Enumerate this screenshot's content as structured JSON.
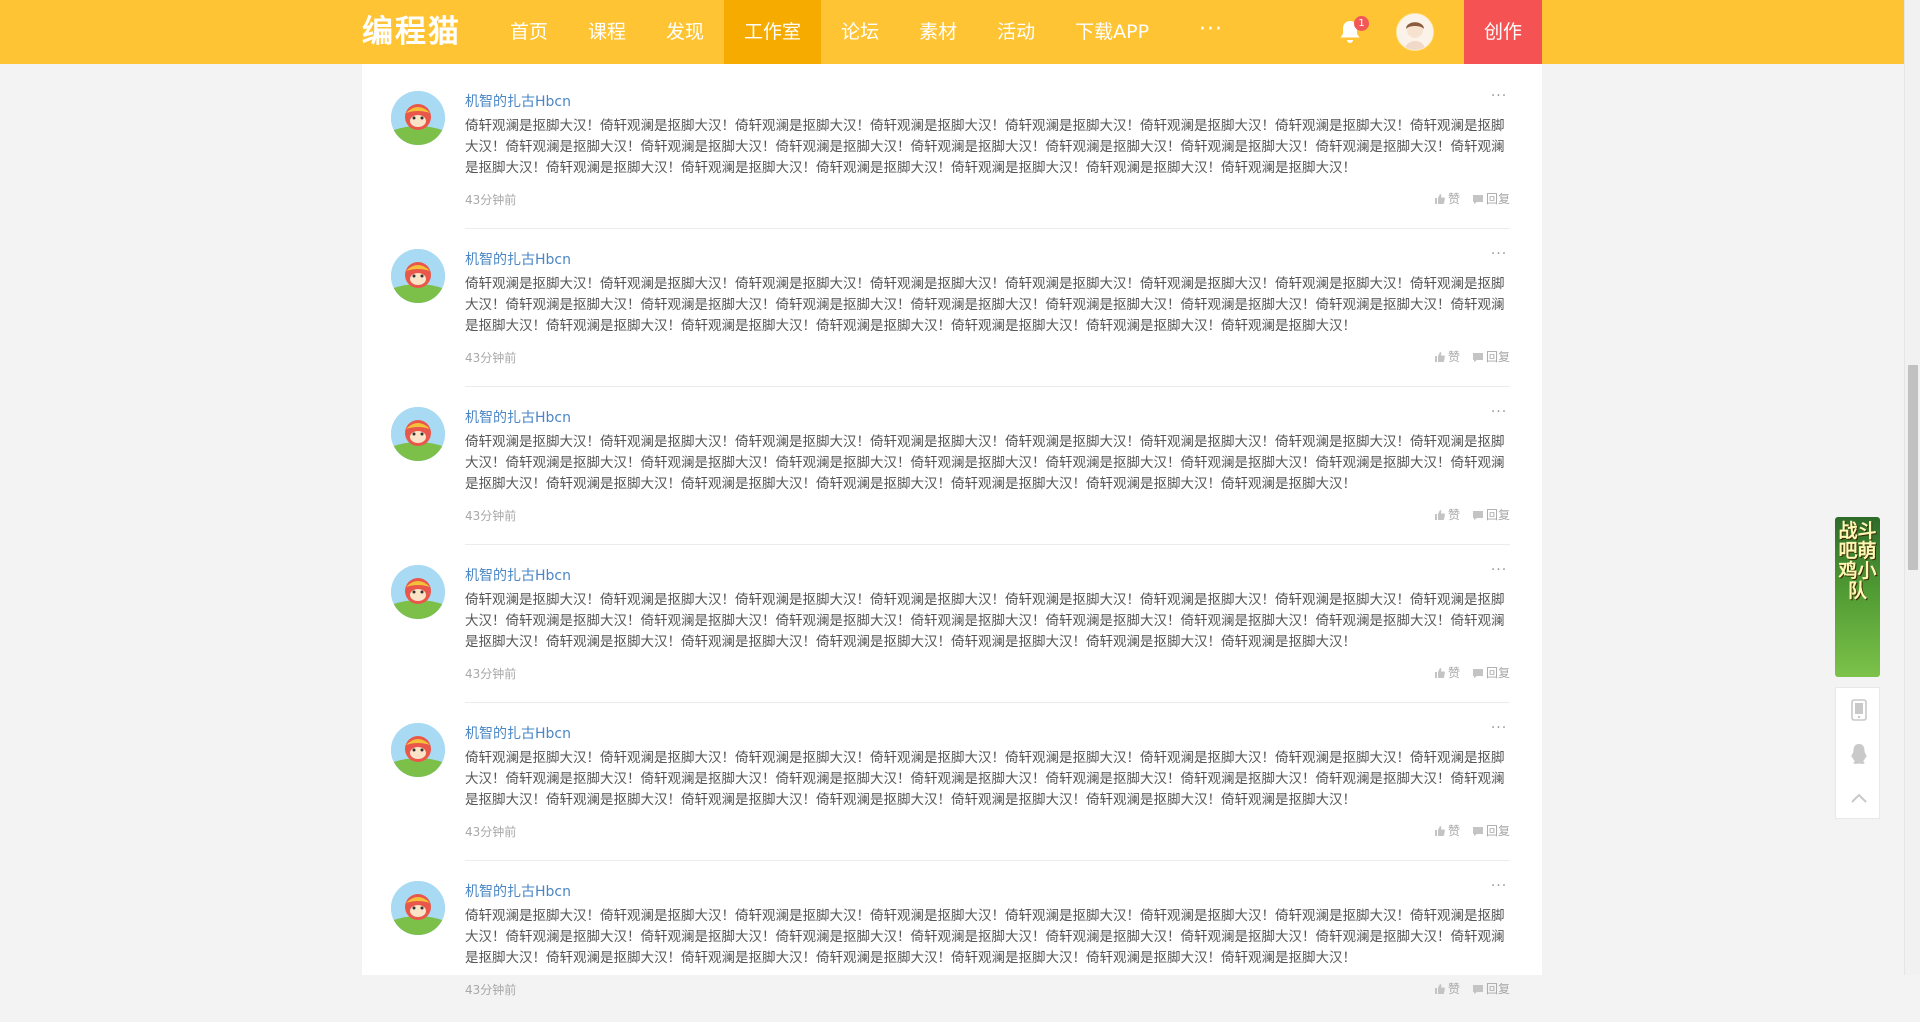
{
  "header": {
    "logo": "编程猫",
    "nav": [
      {
        "label": "首页",
        "active": false
      },
      {
        "label": "课程",
        "active": false
      },
      {
        "label": "发现",
        "active": false
      },
      {
        "label": "工作室",
        "active": true
      },
      {
        "label": "论坛",
        "active": false
      },
      {
        "label": "素材",
        "active": false
      },
      {
        "label": "活动",
        "active": false
      },
      {
        "label": "下载APP",
        "active": false
      }
    ],
    "more_icon": "ellipsis-icon",
    "notification_count": "1",
    "create_label": "创作",
    "colors": {
      "bar": "#fec433",
      "active_tab": "#f5ab00",
      "create": "#f55353"
    }
  },
  "comments": [
    {
      "author": "机智的扎古Hbcn",
      "text": "倚轩观澜是抠脚大汉！倚轩观澜是抠脚大汉！倚轩观澜是抠脚大汉！倚轩观澜是抠脚大汉！倚轩观澜是抠脚大汉！倚轩观澜是抠脚大汉！倚轩观澜是抠脚大汉！倚轩观澜是抠脚大汉！倚轩观澜是抠脚大汉！倚轩观澜是抠脚大汉！倚轩观澜是抠脚大汉！倚轩观澜是抠脚大汉！倚轩观澜是抠脚大汉！倚轩观澜是抠脚大汉！倚轩观澜是抠脚大汉！倚轩观澜是抠脚大汉！倚轩观澜是抠脚大汉！倚轩观澜是抠脚大汉！倚轩观澜是抠脚大汉！倚轩观澜是抠脚大汉！倚轩观澜是抠脚大汉！倚轩观澜是抠脚大汉！",
      "time": "43分钟前",
      "like": "赞",
      "reply": "回复"
    },
    {
      "author": "机智的扎古Hbcn",
      "text": "倚轩观澜是抠脚大汉！倚轩观澜是抠脚大汉！倚轩观澜是抠脚大汉！倚轩观澜是抠脚大汉！倚轩观澜是抠脚大汉！倚轩观澜是抠脚大汉！倚轩观澜是抠脚大汉！倚轩观澜是抠脚大汉！倚轩观澜是抠脚大汉！倚轩观澜是抠脚大汉！倚轩观澜是抠脚大汉！倚轩观澜是抠脚大汉！倚轩观澜是抠脚大汉！倚轩观澜是抠脚大汉！倚轩观澜是抠脚大汉！倚轩观澜是抠脚大汉！倚轩观澜是抠脚大汉！倚轩观澜是抠脚大汉！倚轩观澜是抠脚大汉！倚轩观澜是抠脚大汉！倚轩观澜是抠脚大汉！倚轩观澜是抠脚大汉！",
      "time": "43分钟前",
      "like": "赞",
      "reply": "回复"
    },
    {
      "author": "机智的扎古Hbcn",
      "text": "倚轩观澜是抠脚大汉！倚轩观澜是抠脚大汉！倚轩观澜是抠脚大汉！倚轩观澜是抠脚大汉！倚轩观澜是抠脚大汉！倚轩观澜是抠脚大汉！倚轩观澜是抠脚大汉！倚轩观澜是抠脚大汉！倚轩观澜是抠脚大汉！倚轩观澜是抠脚大汉！倚轩观澜是抠脚大汉！倚轩观澜是抠脚大汉！倚轩观澜是抠脚大汉！倚轩观澜是抠脚大汉！倚轩观澜是抠脚大汉！倚轩观澜是抠脚大汉！倚轩观澜是抠脚大汉！倚轩观澜是抠脚大汉！倚轩观澜是抠脚大汉！倚轩观澜是抠脚大汉！倚轩观澜是抠脚大汉！倚轩观澜是抠脚大汉！",
      "time": "43分钟前",
      "like": "赞",
      "reply": "回复"
    },
    {
      "author": "机智的扎古Hbcn",
      "text": "倚轩观澜是抠脚大汉！倚轩观澜是抠脚大汉！倚轩观澜是抠脚大汉！倚轩观澜是抠脚大汉！倚轩观澜是抠脚大汉！倚轩观澜是抠脚大汉！倚轩观澜是抠脚大汉！倚轩观澜是抠脚大汉！倚轩观澜是抠脚大汉！倚轩观澜是抠脚大汉！倚轩观澜是抠脚大汉！倚轩观澜是抠脚大汉！倚轩观澜是抠脚大汉！倚轩观澜是抠脚大汉！倚轩观澜是抠脚大汉！倚轩观澜是抠脚大汉！倚轩观澜是抠脚大汉！倚轩观澜是抠脚大汉！倚轩观澜是抠脚大汉！倚轩观澜是抠脚大汉！倚轩观澜是抠脚大汉！倚轩观澜是抠脚大汉！",
      "time": "43分钟前",
      "like": "赞",
      "reply": "回复"
    },
    {
      "author": "机智的扎古Hbcn",
      "text": "倚轩观澜是抠脚大汉！倚轩观澜是抠脚大汉！倚轩观澜是抠脚大汉！倚轩观澜是抠脚大汉！倚轩观澜是抠脚大汉！倚轩观澜是抠脚大汉！倚轩观澜是抠脚大汉！倚轩观澜是抠脚大汉！倚轩观澜是抠脚大汉！倚轩观澜是抠脚大汉！倚轩观澜是抠脚大汉！倚轩观澜是抠脚大汉！倚轩观澜是抠脚大汉！倚轩观澜是抠脚大汉！倚轩观澜是抠脚大汉！倚轩观澜是抠脚大汉！倚轩观澜是抠脚大汉！倚轩观澜是抠脚大汉！倚轩观澜是抠脚大汉！倚轩观澜是抠脚大汉！倚轩观澜是抠脚大汉！倚轩观澜是抠脚大汉！",
      "time": "43分钟前",
      "like": "赞",
      "reply": "回复"
    },
    {
      "author": "机智的扎古Hbcn",
      "text": "倚轩观澜是抠脚大汉！倚轩观澜是抠脚大汉！倚轩观澜是抠脚大汉！倚轩观澜是抠脚大汉！倚轩观澜是抠脚大汉！倚轩观澜是抠脚大汉！倚轩观澜是抠脚大汉！倚轩观澜是抠脚大汉！倚轩观澜是抠脚大汉！倚轩观澜是抠脚大汉！倚轩观澜是抠脚大汉！倚轩观澜是抠脚大汉！倚轩观澜是抠脚大汉！倚轩观澜是抠脚大汉！倚轩观澜是抠脚大汉！倚轩观澜是抠脚大汉！倚轩观澜是抠脚大汉！倚轩观澜是抠脚大汉！倚轩观澜是抠脚大汉！倚轩观澜是抠脚大汉！倚轩观澜是抠脚大汉！倚轩观澜是抠脚大汉！",
      "time": "43分钟前",
      "like": "赞",
      "reply": "回复"
    }
  ],
  "float": {
    "banner_text": "战斗吧萌鸡小队",
    "tools": [
      "phone-icon",
      "qq-penguin-icon",
      "back-to-top-icon"
    ]
  }
}
